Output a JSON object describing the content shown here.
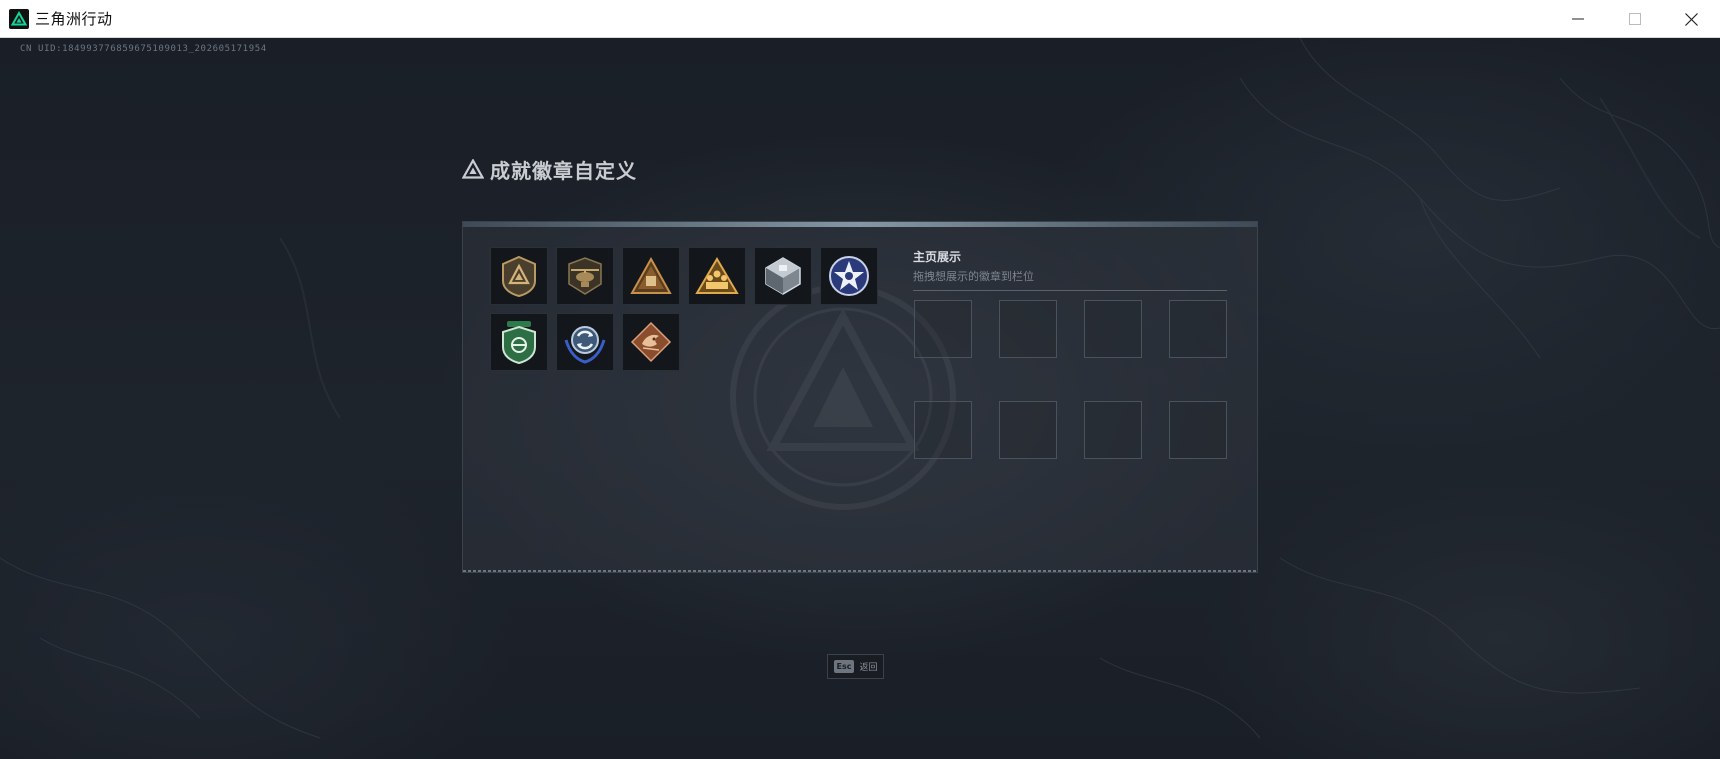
{
  "window": {
    "title": "三角洲行动",
    "logo_icon": "delta-triangle-logo-icon",
    "accent": "#16d49b"
  },
  "header": {
    "uid": "CN UID:184993776859675109013_202605171954"
  },
  "dialog": {
    "title": "成就徽章自定义",
    "badges": [
      {
        "icon": "shield-triangle-badge-icon"
      },
      {
        "icon": "helicopter-badge-icon"
      },
      {
        "icon": "triangle-box-badge-icon"
      },
      {
        "icon": "triangle-team-badge-icon"
      },
      {
        "icon": "crystal-cube-badge-icon"
      },
      {
        "icon": "star-medal-badge-icon"
      },
      {
        "icon": "green-shield-badge-icon"
      },
      {
        "icon": "recycle-wings-badge-icon"
      },
      {
        "icon": "bronze-dragon-badge-icon"
      }
    ],
    "showcase": {
      "title": "主页展示",
      "hint": "拖拽想展示的徽章到栏位",
      "slot_count": 8
    }
  },
  "footer": {
    "esc_key": "Esc",
    "back_label": "返回"
  }
}
